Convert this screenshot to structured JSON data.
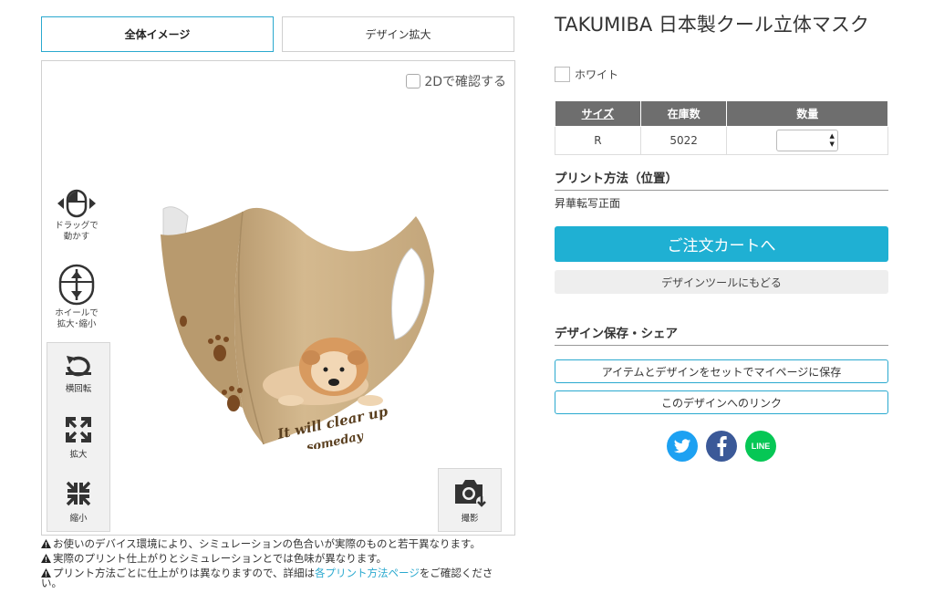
{
  "tabs": {
    "overall": "全体イメージ",
    "zoom": "デザイン拡大"
  },
  "viewer": {
    "check_2d": "2Dで確認する",
    "hint_drag": [
      "ドラッグで",
      "動かす"
    ],
    "hint_wheel": [
      "ホイールで",
      "拡大･縮小"
    ],
    "rotate": "横回転",
    "enlarge": "拡大",
    "shrink": "縮小",
    "photo": "撮影",
    "mask_text": [
      "It will clear up",
      "someday"
    ]
  },
  "notes": {
    "note1": "お使いのデバイス環境により、シミュレーションの色合いが実際のものと若干異なります。",
    "note2": "実際のプリント仕上がりとシミュレーションとでは色味が異なります。",
    "note3_pre": "プリント方法ごとに仕上がりは異なりますので、詳細は",
    "note3_link": "各プリント方法ページ",
    "note3_post": "をご確認ください。"
  },
  "product": {
    "title": "TAKUMIBA 日本製クール立体マスク",
    "color": "ホワイト"
  },
  "stock_table": {
    "headers": [
      "サイズ",
      "在庫数",
      "数量"
    ],
    "rows": [
      {
        "size": "R",
        "stock": "5022",
        "qty": ""
      }
    ]
  },
  "print": {
    "section_title": "プリント方法（位置）",
    "method": "昇華転写正面"
  },
  "buttons": {
    "cart": "ご注文カートへ",
    "back": "デザインツールにもどる",
    "save": "アイテムとデザインをセットでマイページに保存",
    "link": "このデザインへのリンク"
  },
  "share": {
    "section_title": "デザイン保存・シェア",
    "line_label": "LINE"
  },
  "colors": {
    "accent": "#1fb0d3",
    "twitter": "#1da1f2",
    "facebook": "#3b5998",
    "line": "#06c755",
    "mask": "#c9ad84"
  }
}
